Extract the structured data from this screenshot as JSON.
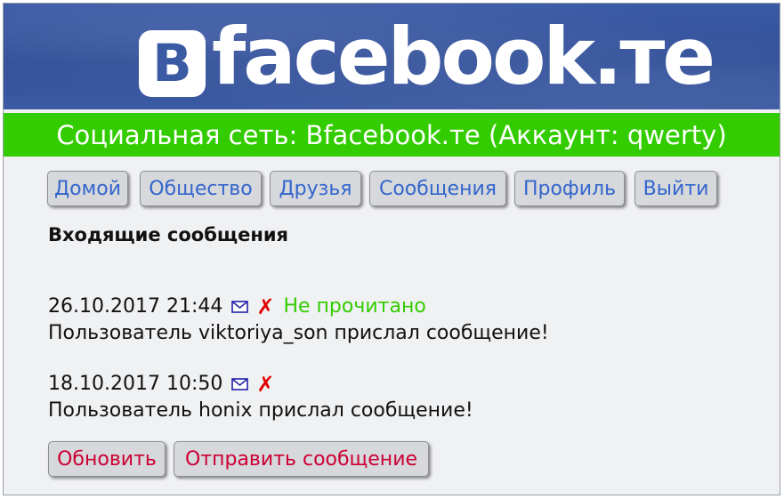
{
  "banner": {
    "logo_letter": "B",
    "logo_text": "facebook.те"
  },
  "header": {
    "title": "Социальная сеть: Bfacebook.те (Аккаунт: qwerty)"
  },
  "nav": {
    "items": [
      {
        "label": "Домой"
      },
      {
        "label": "Общество"
      },
      {
        "label": "Друзья"
      },
      {
        "label": "Сообщения"
      },
      {
        "label": "Профиль"
      },
      {
        "label": "Выйти"
      }
    ]
  },
  "inbox": {
    "heading": "Входящие сообщения",
    "messages": [
      {
        "datetime": "26.10.2017 21:44",
        "status": "Не прочитано",
        "text": "Пользователь viktoriya_son прислал сообщение!",
        "icons": [
          "envelope-icon",
          "delete-icon"
        ]
      },
      {
        "datetime": "18.10.2017 10:50",
        "status": "",
        "text": "Пользователь honix прислал сообщение!",
        "icons": [
          "envelope-icon",
          "delete-icon"
        ]
      }
    ]
  },
  "actions": {
    "refresh_label": "Обновить",
    "send_label": "Отправить сообщение"
  },
  "colors": {
    "banner": "#3b5aa6",
    "header_bar": "#33cc00",
    "nav_link": "#3366cc",
    "action_link": "#cc0033",
    "unread": "#33cc00",
    "delete": "#e00000",
    "page_bg": "#f0f1f3"
  }
}
